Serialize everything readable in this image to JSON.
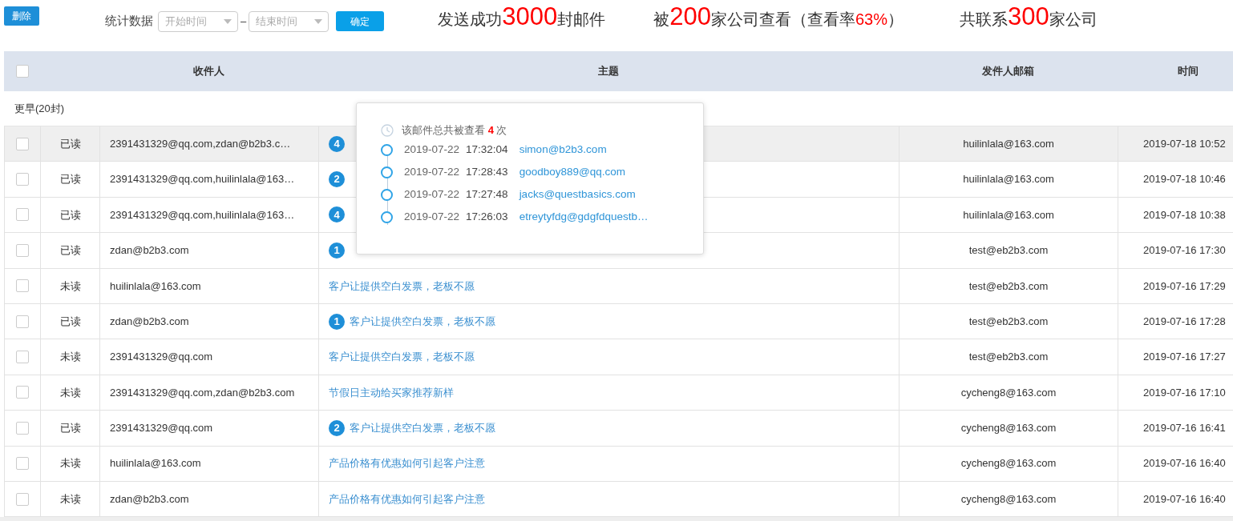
{
  "toolbar": {
    "delete_button": "删除",
    "stats_label": "统计数据",
    "start_field": {
      "placeholder": "开始时间"
    },
    "separator": "–",
    "end_field": {
      "placeholder": "结束时间"
    },
    "confirm_button": "确定"
  },
  "stats": [
    {
      "segments": [
        {
          "kind": "text",
          "text": "发送成功"
        },
        {
          "kind": "number",
          "text": "3000"
        },
        {
          "kind": "text",
          "text": "封邮件"
        }
      ]
    },
    {
      "segments": [
        {
          "kind": "text",
          "text": "被"
        },
        {
          "kind": "number",
          "text": "200"
        },
        {
          "kind": "text",
          "text": "家公司查看（查看率"
        },
        {
          "kind": "percent",
          "text": "63%"
        },
        {
          "kind": "text",
          "text": "）"
        }
      ]
    },
    {
      "segments": [
        {
          "kind": "text",
          "text": "共联系"
        },
        {
          "kind": "number",
          "text": "300"
        },
        {
          "kind": "text",
          "text": "家公司"
        }
      ]
    }
  ],
  "table": {
    "select_all": {
      "checked": false
    },
    "columns": [
      "收件人",
      "主题",
      "发件人邮箱",
      "时间"
    ],
    "group": "更早(20封)",
    "rows": [
      {
        "selected": true,
        "checked": false,
        "status": "已读",
        "recipient": "2391431329@qq.com,zdan@b2b3.c…",
        "badge": "4",
        "sender": "huilinlala@163.com",
        "time": "2019-07-18 10:52"
      },
      {
        "selected": false,
        "checked": false,
        "status": "已读",
        "recipient": "2391431329@qq.com,huilinlala@163…",
        "badge": "2",
        "sender": "huilinlala@163.com",
        "time": "2019-07-18 10:46"
      },
      {
        "selected": false,
        "checked": false,
        "status": "已读",
        "recipient": "2391431329@qq.com,huilinlala@163…",
        "badge": "4",
        "sender": "huilinlala@163.com",
        "time": "2019-07-18 10:38"
      },
      {
        "selected": false,
        "checked": false,
        "status": "已读",
        "recipient": "zdan@b2b3.com",
        "badge": "1",
        "sender": "test@eb2b3.com",
        "time": "2019-07-16 17:30"
      },
      {
        "selected": false,
        "checked": false,
        "status": "未读",
        "recipient": "huilinlala@163.com",
        "subject": "客户让提供空白发票，老板不愿",
        "sender": "test@eb2b3.com",
        "time": "2019-07-16 17:29"
      },
      {
        "selected": false,
        "checked": false,
        "status": "已读",
        "recipient": "zdan@b2b3.com",
        "badge": "1",
        "subject": "客户让提供空白发票，老板不愿",
        "sender": "test@eb2b3.com",
        "time": "2019-07-16 17:28"
      },
      {
        "selected": false,
        "checked": false,
        "status": "未读",
        "recipient": "2391431329@qq.com",
        "subject": "客户让提供空白发票，老板不愿",
        "sender": "test@eb2b3.com",
        "time": "2019-07-16 17:27"
      },
      {
        "selected": false,
        "checked": false,
        "status": "未读",
        "recipient": "2391431329@qq.com,zdan@b2b3.com",
        "subject": "节假日主动给买家推荐新样",
        "sender": "cycheng8@163.com",
        "time": "2019-07-16 17:10"
      },
      {
        "selected": false,
        "checked": false,
        "status": "已读",
        "recipient": "2391431329@qq.com",
        "badge": "2",
        "subject": "客户让提供空白发票，老板不愿",
        "sender": "cycheng8@163.com",
        "time": "2019-07-16 16:41"
      },
      {
        "selected": false,
        "checked": false,
        "status": "未读",
        "recipient": "huilinlala@163.com",
        "subject": "产品价格有优惠如何引起客户注意",
        "sender": "cycheng8@163.com",
        "time": "2019-07-16 16:40"
      },
      {
        "selected": false,
        "checked": false,
        "status": "未读",
        "recipient": "zdan@b2b3.com",
        "subject": "产品价格有优惠如何引起客户注意",
        "sender": "cycheng8@163.com",
        "time": "2019-07-16 16:40"
      }
    ]
  },
  "popover": {
    "summary": [
      {
        "kind": "text",
        "text": "该邮件总共被查看 "
      },
      {
        "kind": "count",
        "text": "4"
      },
      {
        "kind": "text",
        "text": " 次"
      }
    ],
    "views": [
      {
        "date": "2019-07-22",
        "time": "17:32:04",
        "email": "simon@b2b3.com"
      },
      {
        "date": "2019-07-22",
        "time": "17:28:43",
        "email": "goodboy889@qq.com"
      },
      {
        "date": "2019-07-22",
        "time": "17:27:48",
        "email": "jacks@questbasics.com"
      },
      {
        "date": "2019-07-22",
        "time": "17:26:03",
        "email": "etreytyfdg@gdgfdquestb…"
      }
    ]
  }
}
